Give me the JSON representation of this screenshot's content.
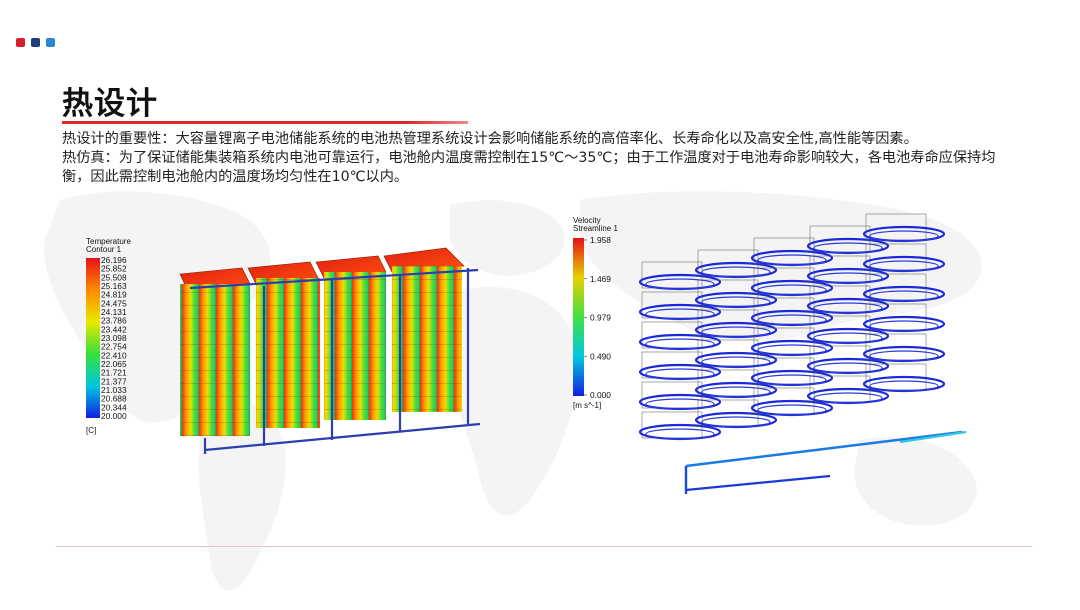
{
  "colors": {
    "dot1": "#d8202a",
    "dot2": "#1f3f7a",
    "dot3": "#2d86d6",
    "title_underline": "#d82a2a",
    "bottom_rule": "#e8c4c4"
  },
  "header": {
    "title": "热设计"
  },
  "body": {
    "paragraph1": "热设计的重要性：大容量锂离子电池储能系统的电池热管理系统设计会影响储能系统的高倍率化、长寿命化以及高安全性,高性能等因素。",
    "paragraph2": "热仿真：为了保证储能集装箱系统内电池可靠运行，电池舱内温度需控制在15℃～35℃；由于工作温度对于电池寿命影响较大，各电池寿命应保持均衡，因此需控制电池舱内的温度场均匀性在10℃以内。"
  },
  "temperature_figure": {
    "legend_title_line1": "Temperature",
    "legend_title_line2": "Contour 1",
    "unit": "[C]",
    "ticks": [
      "26.196",
      "25.852",
      "25.508",
      "25.163",
      "24.819",
      "24.475",
      "24.131",
      "23.786",
      "23.442",
      "23.098",
      "22.754",
      "22.410",
      "22.065",
      "21.721",
      "21.377",
      "21.033",
      "20.688",
      "20.344",
      "20.000"
    ]
  },
  "velocity_figure": {
    "legend_title_line1": "Velocity",
    "legend_title_line2": "Streamline 1",
    "unit": "[m s^-1]",
    "ticks": [
      "1.958",
      "1.469",
      "0.979",
      "0.490",
      "0.000"
    ]
  }
}
